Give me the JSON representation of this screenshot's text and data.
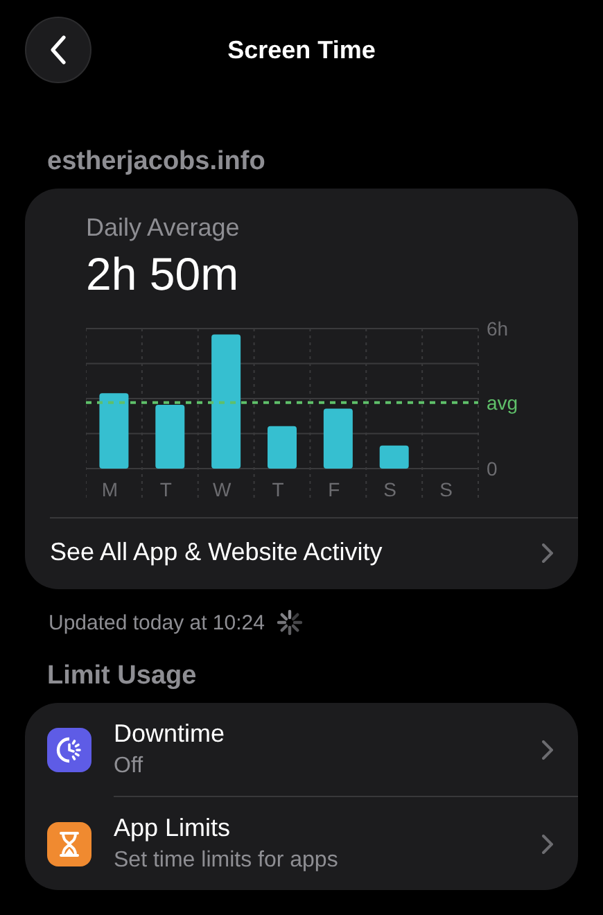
{
  "nav": {
    "title": "Screen Time"
  },
  "account": "estherjacobs.info",
  "summary": {
    "label": "Daily Average",
    "value": "2h 50m",
    "chart_data": {
      "type": "bar",
      "categories": [
        "M",
        "T",
        "W",
        "T",
        "F",
        "S",
        "S"
      ],
      "series": [
        {
          "color": "#36bfd0",
          "values": [
            3.23,
            2.73,
            5.75,
            1.82,
            2.57,
            0.99,
            0
          ]
        }
      ],
      "ylim": [
        0,
        6
      ],
      "yticks": [
        {
          "value": 0,
          "label": "0"
        },
        {
          "value": 6,
          "label": "6h"
        }
      ],
      "ref_lines": [
        {
          "axis": "y",
          "value": 2.83,
          "label": "avg"
        }
      ]
    },
    "link": "See All App & Website Activity"
  },
  "updated": "Updated today at 10:24",
  "limit_usage": {
    "title": "Limit Usage",
    "items": [
      {
        "kind": "downtime",
        "title": "Downtime",
        "subtitle": "Off"
      },
      {
        "kind": "limits",
        "title": "App Limits",
        "subtitle": "Set time limits for apps"
      }
    ]
  }
}
